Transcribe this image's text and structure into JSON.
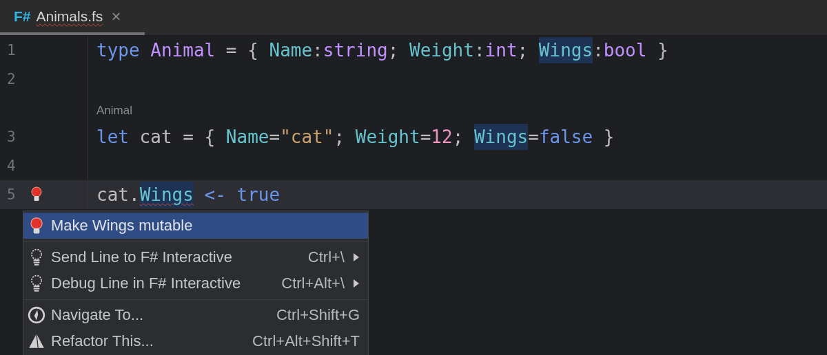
{
  "tab": {
    "badge": "F#",
    "name": "Animals.fs",
    "error": true,
    "selected": true,
    "close": "×"
  },
  "lines": [
    {
      "number": "1",
      "current": false,
      "bulb": false,
      "tokens": [
        {
          "text": "type ",
          "kind": "keyword"
        },
        {
          "text": "Animal",
          "kind": "type"
        },
        {
          "text": " = { ",
          "kind": "plain"
        },
        {
          "text": "Name",
          "kind": "field"
        },
        {
          "text": ":",
          "kind": "plain"
        },
        {
          "text": "string",
          "kind": "type"
        },
        {
          "text": "; ",
          "kind": "plain"
        },
        {
          "text": "Weight",
          "kind": "field"
        },
        {
          "text": ":",
          "kind": "plain"
        },
        {
          "text": "int",
          "kind": "type"
        },
        {
          "text": "; ",
          "kind": "plain"
        },
        {
          "text": "Wings",
          "kind": "field",
          "highlighted": true
        },
        {
          "text": ":",
          "kind": "plain"
        },
        {
          "text": "bool",
          "kind": "type"
        },
        {
          "text": " }",
          "kind": "plain"
        }
      ]
    },
    {
      "number": "2",
      "current": false,
      "bulb": false
    },
    {
      "number": "3",
      "hint": "Animal",
      "current": false,
      "bulb": false,
      "tokens": [
        {
          "text": "let",
          "kind": "keyword"
        },
        {
          "text": " cat = { ",
          "kind": "plain"
        },
        {
          "text": "Name",
          "kind": "field"
        },
        {
          "text": "=",
          "kind": "plain"
        },
        {
          "text": "\"cat\"",
          "kind": "string"
        },
        {
          "text": "; ",
          "kind": "plain"
        },
        {
          "text": "Weight",
          "kind": "field"
        },
        {
          "text": "=",
          "kind": "plain"
        },
        {
          "text": "12",
          "kind": "number"
        },
        {
          "text": "; ",
          "kind": "plain"
        },
        {
          "text": "Wings",
          "kind": "field",
          "highlighted": true
        },
        {
          "text": "=",
          "kind": "plain"
        },
        {
          "text": "false",
          "kind": "keyword"
        },
        {
          "text": " }",
          "kind": "plain"
        }
      ]
    },
    {
      "number": "4",
      "current": false,
      "bulb": false
    },
    {
      "number": "5",
      "current": true,
      "bulb": true,
      "tokens": [
        {
          "text": "cat.",
          "kind": "plain"
        },
        {
          "text": "Wings",
          "kind": "field",
          "highlighted": true,
          "error": true
        },
        {
          "text": " <- ",
          "kind": "keyword"
        },
        {
          "text": "true",
          "kind": "keyword"
        }
      ]
    }
  ],
  "menu": [
    {
      "kind": "fix",
      "label": "Make Wings mutable",
      "selected": true
    },
    {
      "kind": "separator"
    },
    {
      "kind": "action",
      "label": "Send Line to F# Interactive",
      "shortcut": "Ctrl+\\",
      "submenu": true,
      "selected": false
    },
    {
      "kind": "action",
      "label": "Debug Line in F# Interactive",
      "shortcut": "Ctrl+Alt+\\",
      "submenu": true,
      "selected": false
    },
    {
      "kind": "separator"
    },
    {
      "kind": "navigate",
      "label": "Navigate To...",
      "shortcut": "Ctrl+Shift+G",
      "selected": false
    },
    {
      "kind": "refactor",
      "label": "Refactor This...",
      "shortcut": "Ctrl+Alt+Shift+T",
      "selected": false
    }
  ]
}
